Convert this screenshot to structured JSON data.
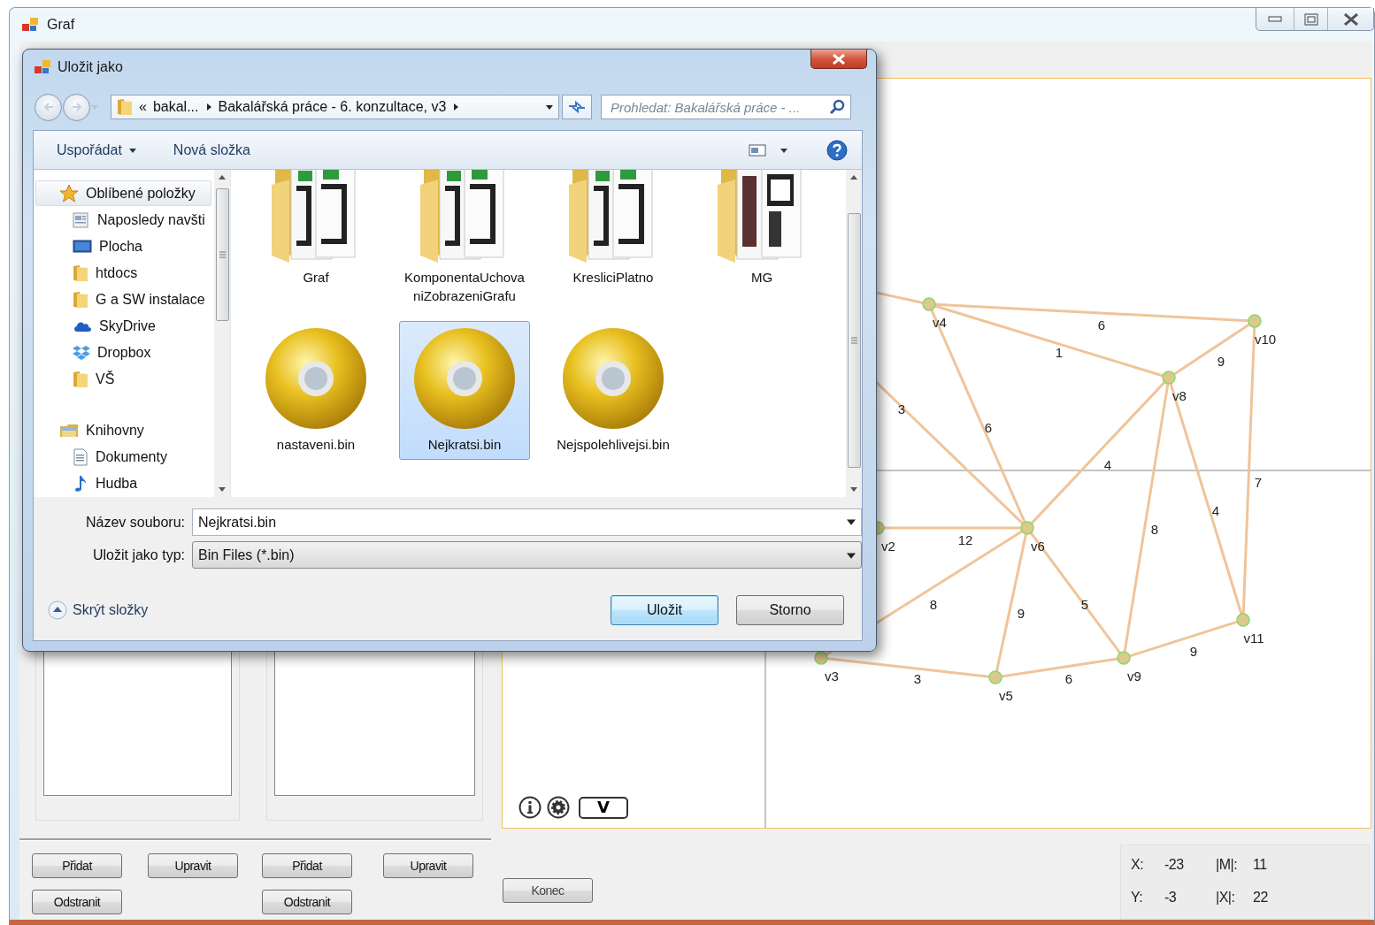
{
  "window": {
    "title": "Graf"
  },
  "list_panels": [
    {
      "add": "Přidat",
      "edit": "Upravit",
      "remove": "Odstranit"
    },
    {
      "add": "Přidat",
      "edit": "Upravit",
      "remove": "Odstranit"
    }
  ],
  "canvas": {
    "mode_button": "V",
    "nodes": [
      {
        "label": "v4"
      },
      {
        "label": "v10"
      },
      {
        "label": "v8"
      },
      {
        "label": "v2"
      },
      {
        "label": "v6"
      },
      {
        "label": "v11"
      },
      {
        "label": "v3"
      },
      {
        "label": "v9"
      },
      {
        "label": "v5"
      }
    ],
    "edges": [
      {
        "weight": "6"
      },
      {
        "weight": "1"
      },
      {
        "weight": "9"
      },
      {
        "weight": "7"
      },
      {
        "weight": "6"
      },
      {
        "weight": "3"
      },
      {
        "weight": "4"
      },
      {
        "weight": "8"
      },
      {
        "weight": "4"
      },
      {
        "weight": "12"
      },
      {
        "weight": "8"
      },
      {
        "weight": "9"
      },
      {
        "weight": "5"
      },
      {
        "weight": "3"
      },
      {
        "weight": "6"
      },
      {
        "weight": "9"
      }
    ]
  },
  "exit_button": "Konec",
  "status": [
    {
      "label": "X:",
      "value": "-23"
    },
    {
      "label": "|M|:",
      "value": "11"
    },
    {
      "label": "Y:",
      "value": "-3"
    },
    {
      "label": "|X|:",
      "value": "22"
    }
  ],
  "dialog": {
    "title": "Uložit jako",
    "breadcrumb": {
      "overflow": "«",
      "parts": [
        "bakal...",
        "Bakalářská práce - 6. konzultace, v3"
      ]
    },
    "search": {
      "placeholder": "Prohledat: Bakalářská práce - ..."
    },
    "toolbar": {
      "organize": "Uspořádat",
      "new_folder": "Nová složka"
    },
    "nav_tree": [
      {
        "label": "Oblíbené položky",
        "selected": true,
        "children": [
          {
            "label": "Naposledy navšti",
            "selected": false
          },
          {
            "label": "Plocha",
            "selected": false
          },
          {
            "label": "htdocs",
            "selected": false
          },
          {
            "label": "G a SW instalace",
            "selected": false
          },
          {
            "label": "SkyDrive",
            "selected": false
          },
          {
            "label": "Dropbox",
            "selected": false
          },
          {
            "label": "VŠ",
            "selected": false
          }
        ]
      },
      {
        "label": "Knihovny",
        "selected": false,
        "children": [
          {
            "label": "Dokumenty",
            "selected": false
          },
          {
            "label": "Hudba",
            "selected": false
          }
        ]
      }
    ],
    "files": [
      {
        "name": "Graf",
        "kind": "folder",
        "selected": false
      },
      {
        "name": "KomponentaUchovaniZobrazeniGrafu",
        "kind": "folder",
        "selected": false
      },
      {
        "name": "KresliciPlatno",
        "kind": "folder",
        "selected": false
      },
      {
        "name": "MG",
        "kind": "folder",
        "selected": false
      },
      {
        "name": "nastaveni.bin",
        "kind": "file",
        "selected": false
      },
      {
        "name": "Nejkratsi.bin",
        "kind": "file",
        "selected": true
      },
      {
        "name": "Nejspolehlivejsi.bin",
        "kind": "file",
        "selected": false
      }
    ],
    "fields": [
      {
        "label": "Název souboru:",
        "value": "Nejkratsi.bin",
        "kind": "editable"
      },
      {
        "label": "Uložit jako typ:",
        "value": "Bin Files (*.bin)",
        "kind": "dropdown"
      }
    ],
    "hide_folders": "Skrýt složky",
    "buttons": [
      {
        "label": "Uložit",
        "default": true
      },
      {
        "label": "Storno",
        "default": false
      }
    ]
  }
}
